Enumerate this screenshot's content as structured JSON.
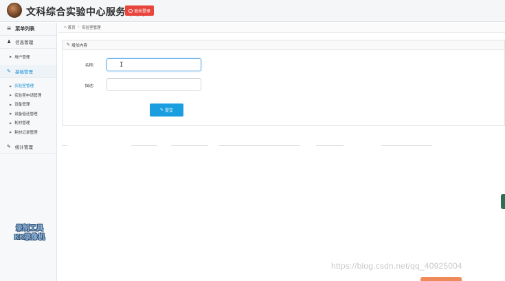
{
  "header": {
    "title": "文科综合实验中心服务平台",
    "logout_label": "退出登录"
  },
  "sidebar": {
    "menu_title": "菜单列表",
    "groups": [
      {
        "label": "信息管理",
        "items": [
          {
            "label": "用户管理"
          }
        ]
      },
      {
        "label": "基础管理",
        "items": [
          {
            "label": "实验室管理"
          },
          {
            "label": "实验室申请管理"
          },
          {
            "label": "设备管理"
          },
          {
            "label": "设备借还管理"
          },
          {
            "label": "耗材管理"
          },
          {
            "label": "耗材记录管理"
          }
        ]
      },
      {
        "label": "统计管理",
        "items": []
      }
    ]
  },
  "breadcrumb": {
    "home": "首页",
    "current": "实验室管理"
  },
  "panel": {
    "title": "增加内容",
    "fields": [
      {
        "label": "名称：",
        "value": ""
      },
      {
        "label": "描述：",
        "value": ""
      }
    ],
    "submit_label": "提交"
  },
  "watermarks": {
    "tool_line1": "录制工具",
    "tool_line2": "KK录像机",
    "blog": "https://blog.csdn.net/qq_40925004"
  }
}
